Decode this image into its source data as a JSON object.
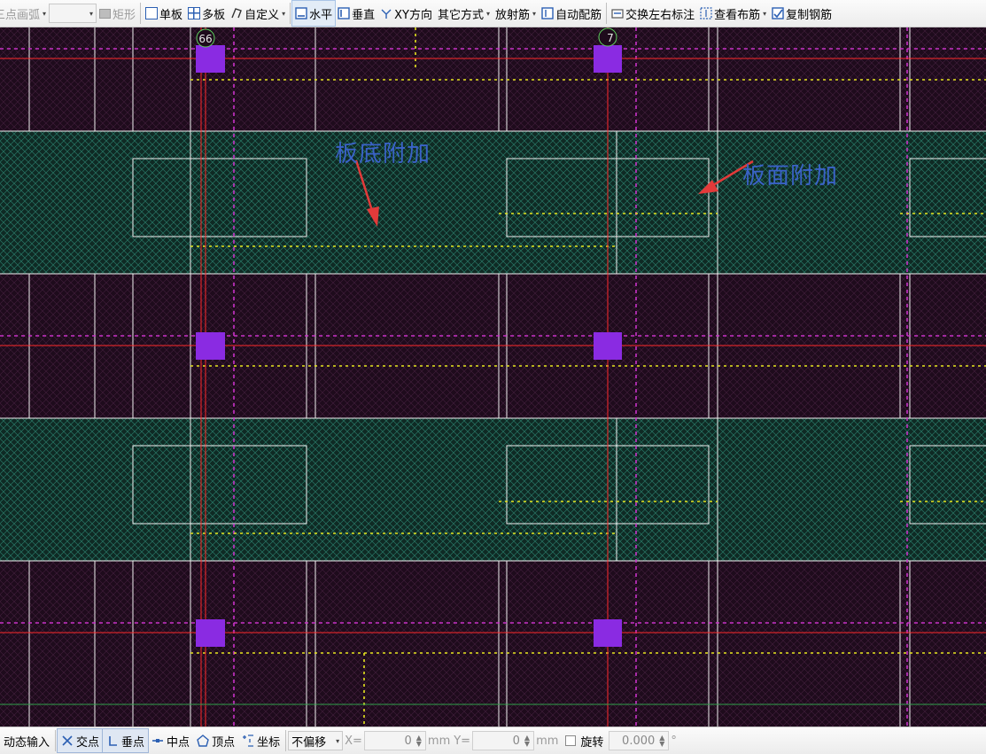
{
  "toolbar": {
    "arc_label": "三点画弧",
    "rect_label": "矩形",
    "single_label": "单板",
    "multi_label": "多板",
    "custom_label": "自定义",
    "horizontal_label": "水平",
    "vertical_label": "垂直",
    "xy_label": "XY方向",
    "other_label": "其它方式",
    "radial_label": "放射筋",
    "auto_label": "自动配筋",
    "swap_label": "交换左右标注",
    "view_label": "查看布筋",
    "copy_label": "复制钢筋"
  },
  "canvas": {
    "axis_labels": [
      "66",
      "7"
    ],
    "annotations": {
      "bottom_extra": "板底附加",
      "top_extra": "板面附加"
    },
    "colors": {
      "background": "#1e0b1c",
      "slab_fill": "#0f2a24",
      "hatch": "#2f8f7a",
      "column": "#8a2be2",
      "axis_line": "#ff2a2a",
      "rebar_dash": "#c832c8",
      "yellow_dash": "#e6e61e",
      "beam_edge": "#f0f0f0",
      "annotation_text": "#3a62c8",
      "arrow": "#e23a3a"
    }
  },
  "statusbar": {
    "dynamic_input": "动态输入",
    "intersection": "交点",
    "perpendicular": "垂点",
    "midpoint": "中点",
    "vertex": "顶点",
    "coordinate": "坐标",
    "offset_mode": "不偏移",
    "x_label": "X=",
    "x_value": "0",
    "unit1": "mm",
    "y_label": "Y=",
    "y_value": "0",
    "unit2": "mm",
    "rotate_label": "旋转",
    "rotate_value": "0.000",
    "degree": "°"
  }
}
